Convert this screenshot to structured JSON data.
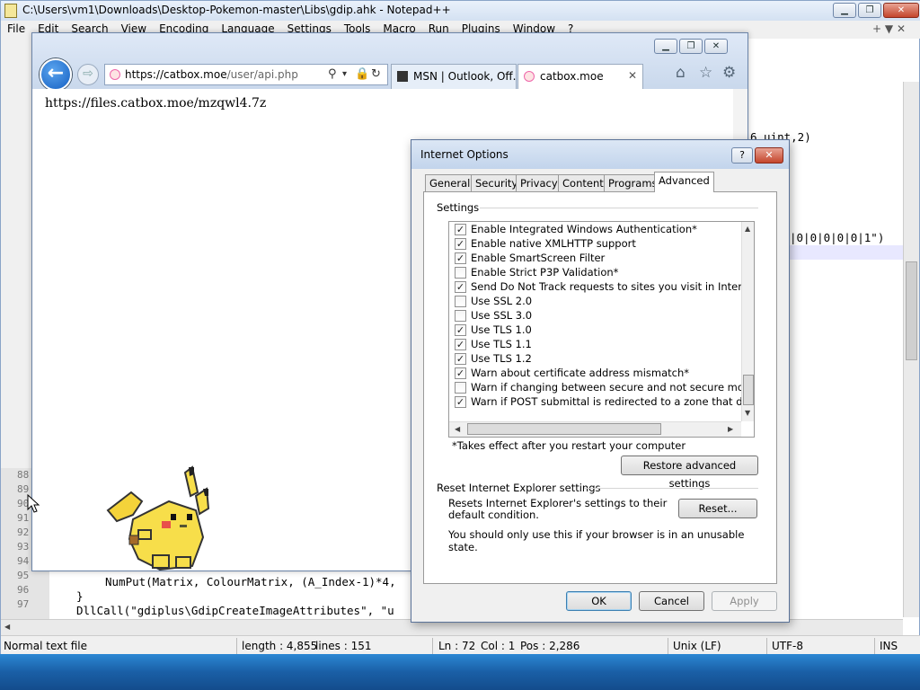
{
  "notepad": {
    "title": "C:\\Users\\vm1\\Downloads\\Desktop-Pokemon-master\\Libs\\gdip.ahk - Notepad++",
    "menu": [
      "File",
      "Edit",
      "Search",
      "View",
      "Encoding",
      "Language",
      "Settings",
      "Tools",
      "Macro",
      "Run",
      "Plugins",
      "Window",
      "?"
    ],
    "menu_right": "+ ▼ ✕",
    "line_numbers": [
      "88",
      "89",
      "90",
      "91",
      "92",
      "93",
      "94",
      "95",
      "96",
      "97"
    ],
    "code_fragments": {
      "top_right": "6.uint,2)",
      "mid_right": "|0|0|0|0|0|1\")",
      "line95": "NumPut(Matrix, ColourMatrix, (A_Index-1)*4,",
      "line96": "}",
      "line97": "DllCall(\"gdiplus\\GdipCreateImageAttributes\", \"u"
    },
    "status": {
      "type": "Normal text file",
      "length": "length : 4,855",
      "lines": "lines : 151",
      "ln": "Ln : 72",
      "col": "Col : 1",
      "pos": "Pos : 2,286",
      "eol": "Unix (LF)",
      "encoding": "UTF-8",
      "mode": "INS"
    }
  },
  "ie": {
    "url_host": "https://catbox.moe",
    "url_path": "/user/api.php",
    "tabs": [
      {
        "label": "MSN | Outlook, Off..."
      },
      {
        "label": "catbox.moe"
      }
    ],
    "page_text": "https://files.catbox.moe/mzqwl4.7z"
  },
  "dialog": {
    "title": "Internet Options",
    "help": "?",
    "close": "✕",
    "tabs": [
      "General",
      "Security",
      "Privacy",
      "Content",
      "Programs",
      "Advanced"
    ],
    "active_tab": "Advanced",
    "settings_label": "Settings",
    "settings": [
      {
        "label": "Enable Integrated Windows Authentication*",
        "checked": true
      },
      {
        "label": "Enable native XMLHTTP support",
        "checked": true
      },
      {
        "label": "Enable SmartScreen Filter",
        "checked": true
      },
      {
        "label": "Enable Strict P3P Validation*",
        "checked": false
      },
      {
        "label": "Send Do Not Track requests to sites you visit in Internet E",
        "checked": true
      },
      {
        "label": "Use SSL 2.0",
        "checked": false
      },
      {
        "label": "Use SSL 3.0",
        "checked": false
      },
      {
        "label": "Use TLS 1.0",
        "checked": true
      },
      {
        "label": "Use TLS 1.1",
        "checked": true
      },
      {
        "label": "Use TLS 1.2",
        "checked": true
      },
      {
        "label": "Warn about certificate address mismatch*",
        "checked": true
      },
      {
        "label": "Warn if changing between secure and not secure mode",
        "checked": false
      },
      {
        "label": "Warn if POST submittal is redirected to a zone that does n",
        "checked": true
      }
    ],
    "note": "*Takes effect after you restart your computer",
    "restore_button": "Restore advanced settings",
    "reset_section": "Reset Internet Explorer settings",
    "reset_desc": "Resets Internet Explorer's settings to their default condition.",
    "reset_button": "Reset...",
    "reset_warning": "You should only use this if your browser is in an unusable state.",
    "ok": "OK",
    "cancel": "Cancel",
    "apply": "Apply"
  },
  "colors": {
    "accent": "#1560c3",
    "taskbar": "#1a5fa6",
    "close_red": "#c4452c"
  },
  "icons": [
    "back-arrow-icon",
    "forward-arrow-icon",
    "search-icon",
    "lock-icon",
    "refresh-icon",
    "home-icon",
    "star-icon",
    "gear-icon",
    "close-icon",
    "minimize-icon",
    "maximize-icon",
    "help-icon",
    "checkbox-icon",
    "scroll-arrow-icon"
  ]
}
